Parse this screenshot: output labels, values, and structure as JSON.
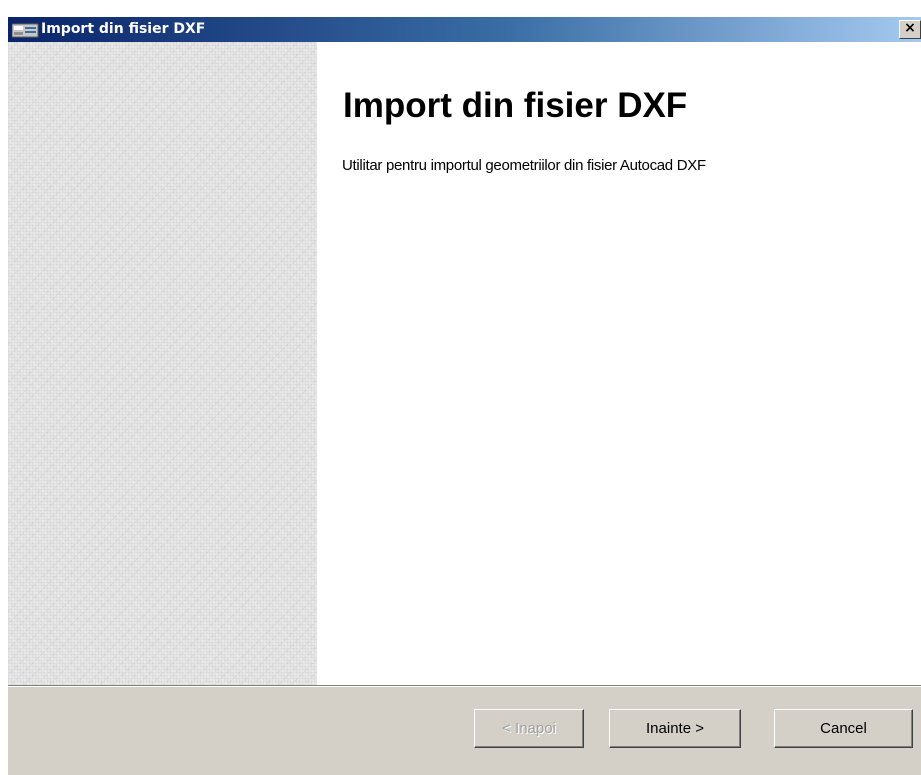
{
  "window": {
    "title": "Import din fisier DXF",
    "close_glyph": "×",
    "title_icon": "dxf-app-icon"
  },
  "content": {
    "title": "Import din fisier DXF",
    "description": "Utilitar pentru importul geometriilor din fisier Autocad DXF"
  },
  "buttons": {
    "back_label": "< Inapoi",
    "back_enabled": false,
    "next_label": "Inainte >",
    "cancel_label": "Cancel"
  },
  "colors": {
    "titlebar_start": "#0a246a",
    "titlebar_end": "#a6caf0",
    "dialog_face": "#d4d0c8",
    "content_bg": "#ffffff",
    "disabled_text": "#a0a0a0"
  }
}
